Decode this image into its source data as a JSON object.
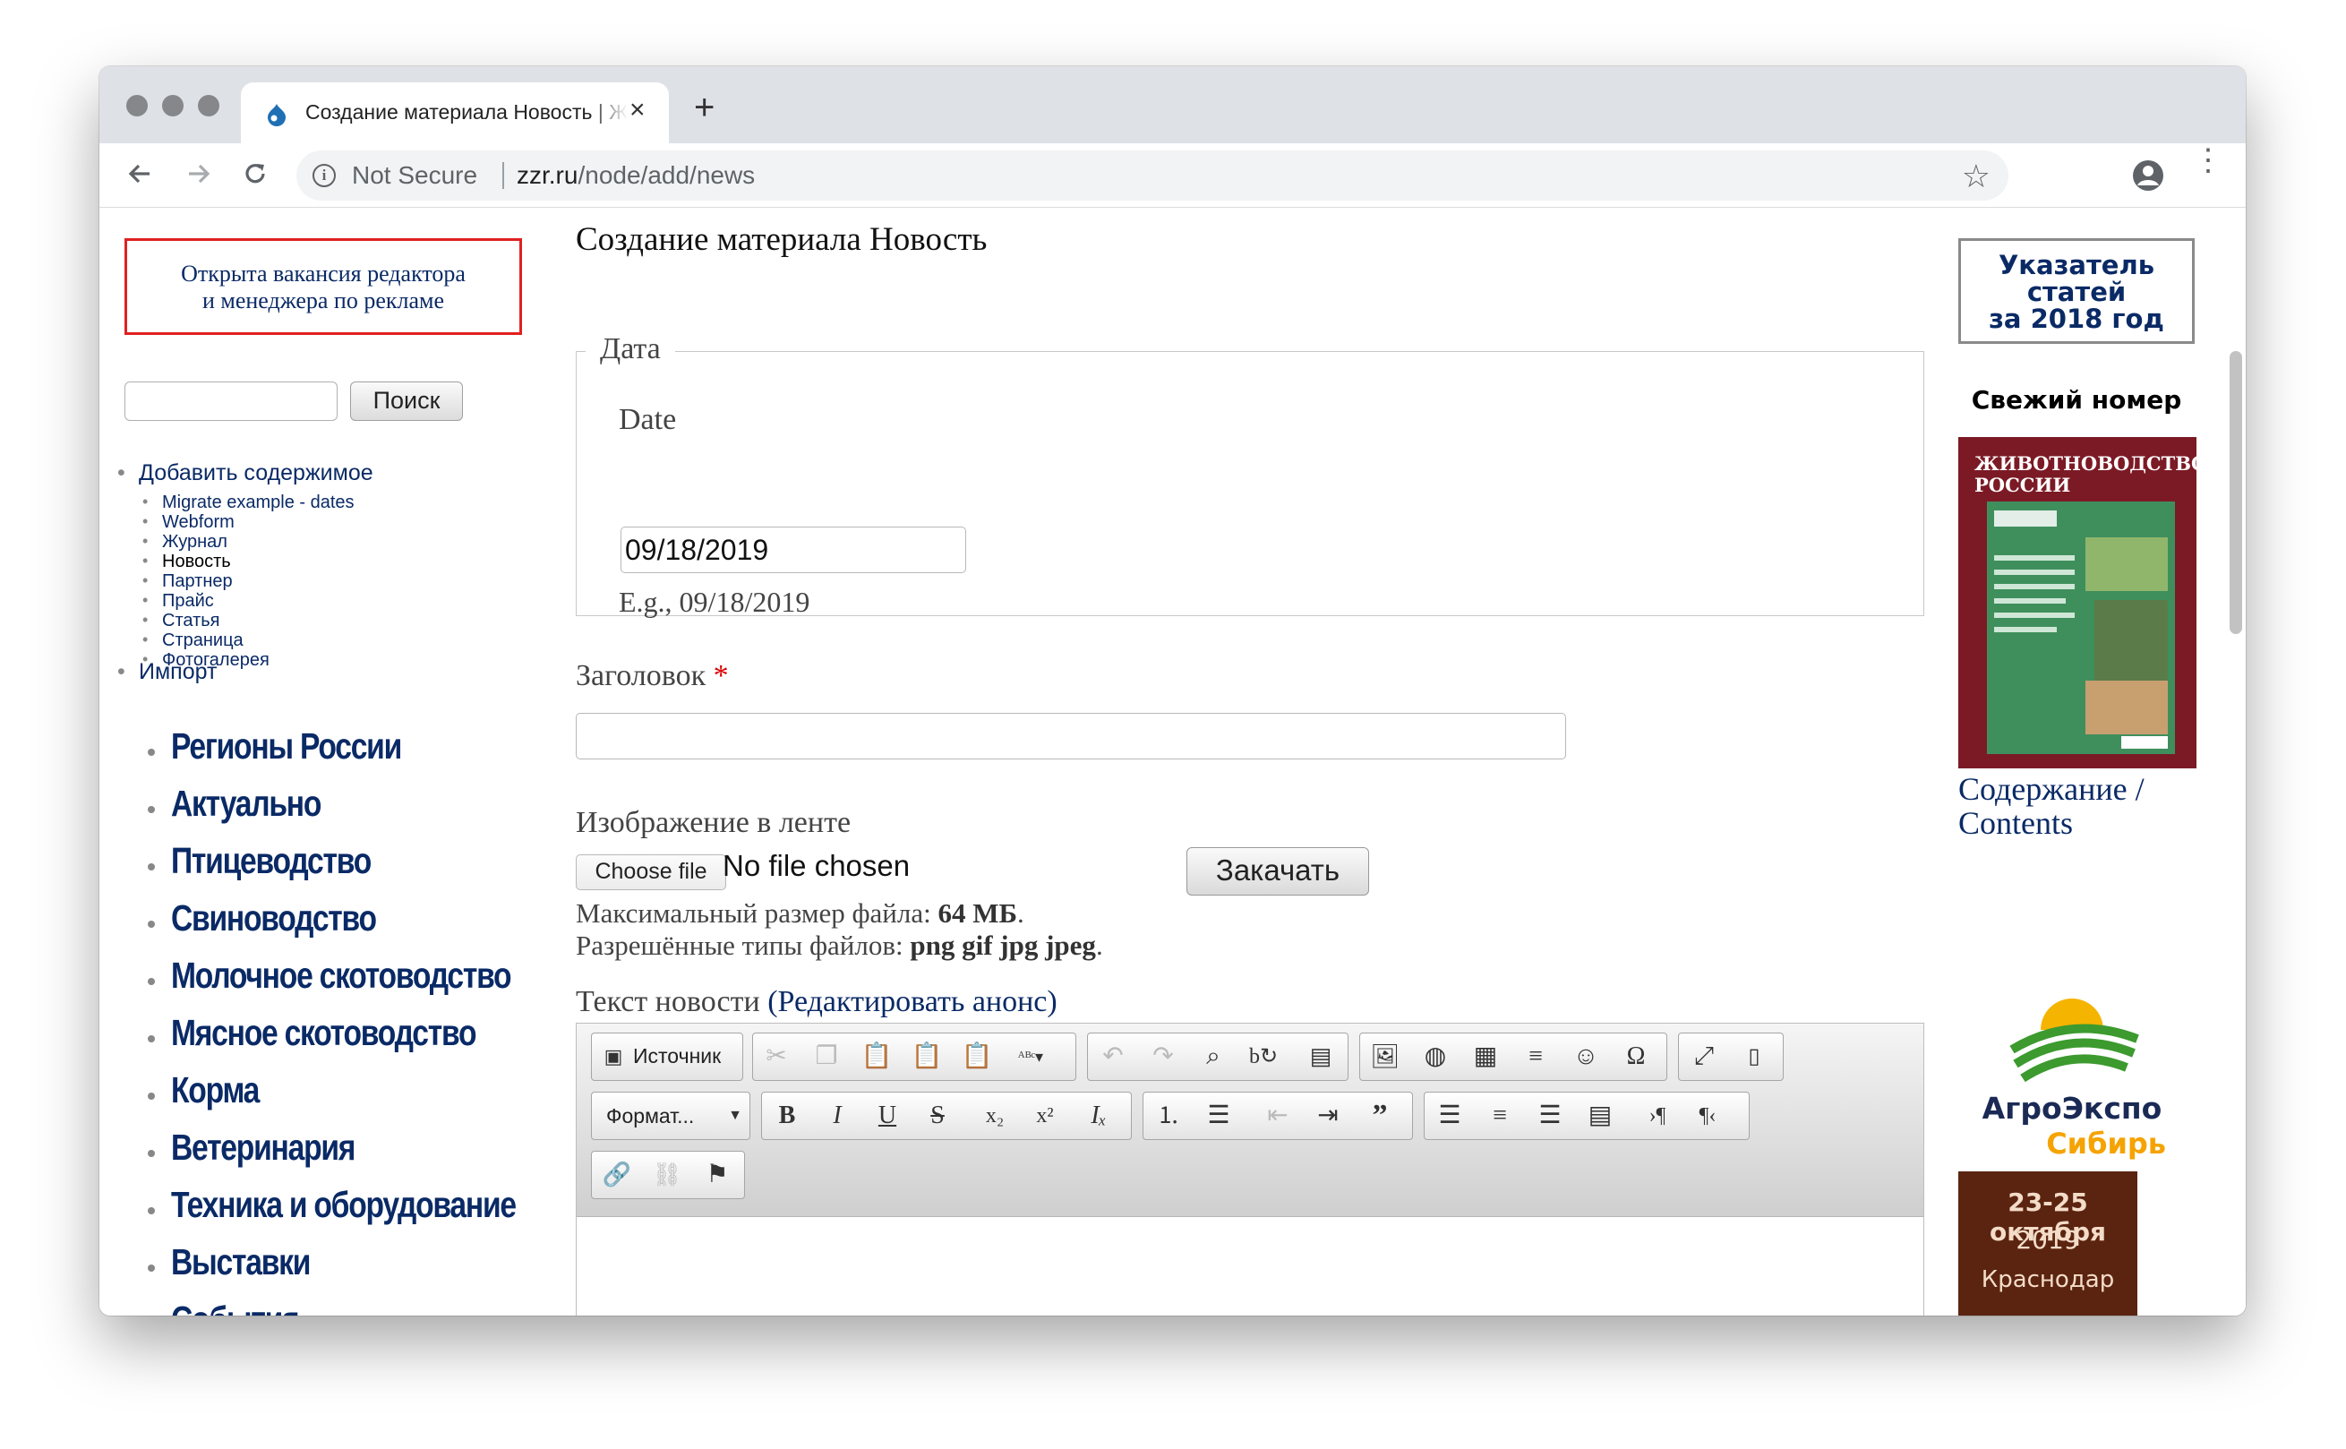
{
  "browser": {
    "tab_title": "Создание материала Новость | ЖЖР",
    "tab_close": "×",
    "new_tab": "+",
    "security_label": "Not Secure",
    "url_domain": "zzr.ru",
    "url_path": "/node/add/news",
    "icons": {
      "back": "arrow-left-icon",
      "forward": "arrow-right-icon",
      "reload": "reload-icon",
      "info": "info-icon",
      "bookmark": "star-icon",
      "profile": "profile-icon",
      "menu": "kebab-menu-icon"
    }
  },
  "left_sidebar": {
    "vacancy_line1": "Открыта вакансия редактора",
    "vacancy_line2": "и менеджера по рекламе",
    "search_button": "Поиск",
    "admin_menu": {
      "add_content": "Добавить содержимое",
      "content_types": [
        "Migrate example - dates",
        "Webform",
        "Журнал",
        "Новость",
        "Партнер",
        "Прайс",
        "Статья",
        "Страница",
        "Фотогалерея"
      ],
      "active_type": "Новость",
      "import": "Импорт"
    },
    "categories": [
      "Регионы России",
      "Актуально",
      "Птицеводство",
      "Свиноводство",
      "Молочное скотоводство",
      "Мясное скотоводство",
      "Корма",
      "Ветеринария",
      "Техника и оборудование",
      "Выставки",
      "События"
    ]
  },
  "main": {
    "page_title": "Создание материала Новость",
    "date_fieldset": {
      "legend": "Дата",
      "label": "Date",
      "value": "09/18/2019",
      "hint": "E.g., 09/18/2019"
    },
    "title_field": {
      "label": "Заголовок",
      "required_marker": "*",
      "value": ""
    },
    "image_field": {
      "label": "Изображение в ленте",
      "choose_button": "Choose file",
      "status": "No file chosen",
      "upload_button": "Закачать",
      "max_size_label": "Максимальный размер файла:",
      "max_size_value": "64 МБ",
      "types_label": "Разрешённые типы файлов:",
      "types_value": "png gif jpg jpeg"
    },
    "body_field": {
      "label": "Текст новости",
      "edit_summary_link": "(Редактировать анонс)"
    },
    "editor_toolbar": {
      "source": "Источник",
      "format": "Формат..."
    }
  },
  "right_sidebar": {
    "index_line1": "Указатель",
    "index_line2": "статей",
    "index_line3": "за 2018 год",
    "fresh_issue": "Свежий номер",
    "magazine_title": "ЖИВОТНОВОДСТВО РОССИИ",
    "contents_line1": "Содержание /",
    "contents_line2": "Contents",
    "agro_name": "АгроЭкспо",
    "agro_sub": "Сибирь",
    "expo_dates": "23-25 октября",
    "expo_year": "2019",
    "expo_city": "Краснодар"
  }
}
